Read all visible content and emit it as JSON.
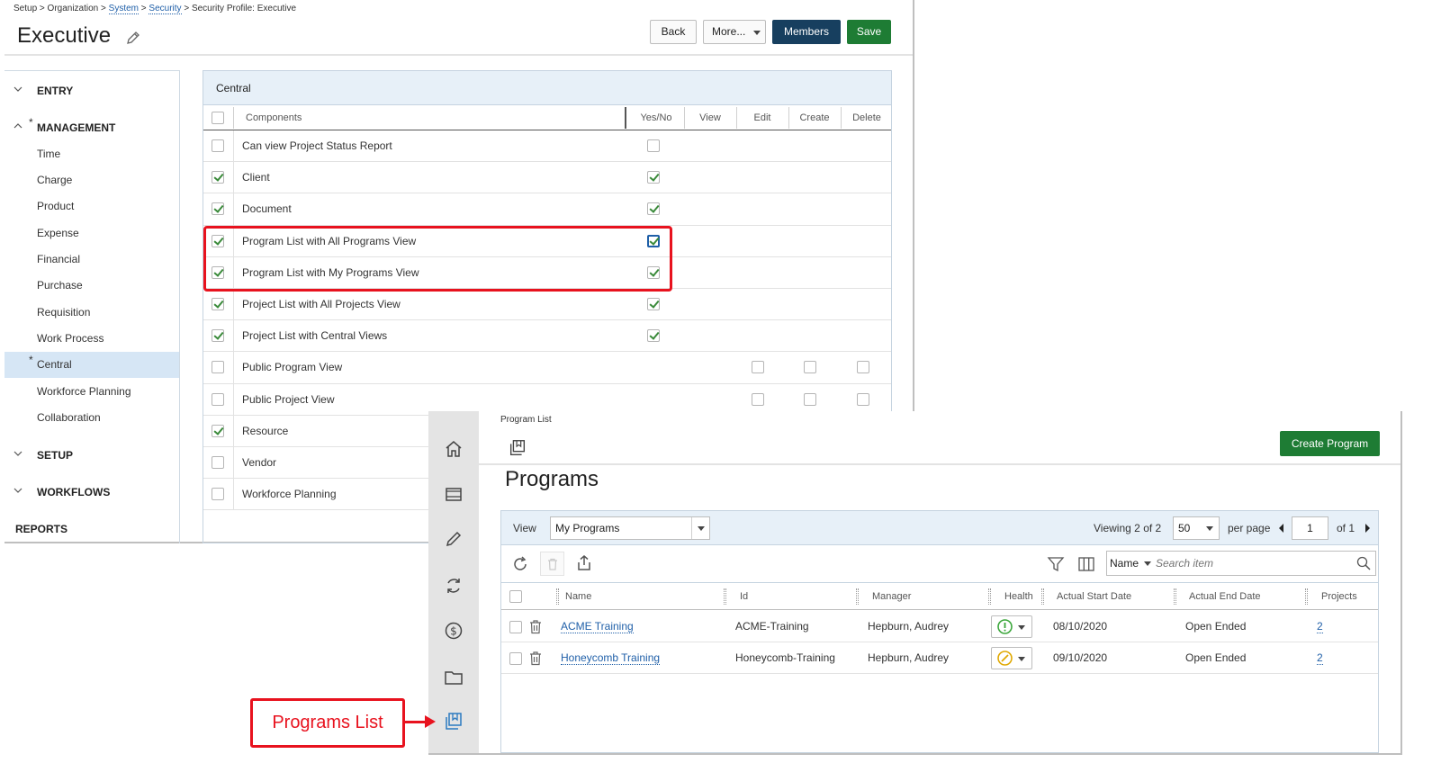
{
  "security_profile": {
    "breadcrumb": {
      "setup": "Setup",
      "sep": ">",
      "organization": "Organization",
      "system": "System",
      "security": "Security",
      "current": "Security Profile: Executive"
    },
    "title": "Executive",
    "buttons": {
      "back": "Back",
      "more": "More...",
      "members": "Members",
      "save": "Save"
    },
    "colors": {
      "members": "#173f5f",
      "save": "#1e7c34",
      "highlight": "#e8121e"
    },
    "nav": {
      "entry": "ENTRY",
      "management": "MANAGEMENT",
      "management_marker": "*",
      "items": [
        "Time",
        "Charge",
        "Product",
        "Expense",
        "Financial",
        "Purchase",
        "Requisition",
        "Work Process",
        "Central",
        "Workforce Planning",
        "Collaboration"
      ],
      "active_item": "Central",
      "active_marker": "*",
      "setup": "SETUP",
      "workflows": "WORKFLOWS",
      "reports": "REPORTS"
    },
    "components": {
      "section_title": "Central",
      "headers": {
        "components": "Components",
        "yes_no": "Yes/No",
        "view": "View",
        "edit": "Edit",
        "create": "Create",
        "delete": "Delete"
      },
      "rows": [
        {
          "label": "Can view Project Status Report",
          "selected": false,
          "yes_no": false,
          "vecd": false
        },
        {
          "label": "Client",
          "selected": true,
          "yes_no": true,
          "vecd": false
        },
        {
          "label": "Document",
          "selected": true,
          "yes_no": true,
          "vecd": false
        },
        {
          "label": "Program List with All Programs View",
          "selected": true,
          "yes_no": true,
          "vecd": false,
          "focused": true
        },
        {
          "label": "Program List with My Programs View",
          "selected": true,
          "yes_no": true,
          "vecd": false
        },
        {
          "label": "Project List with All Projects View",
          "selected": true,
          "yes_no": true,
          "vecd": false
        },
        {
          "label": "Project List with Central Views",
          "selected": true,
          "yes_no": true,
          "vecd": false
        },
        {
          "label": "Public Program View",
          "selected": false,
          "yes_no": null,
          "vecd": true
        },
        {
          "label": "Public Project View",
          "selected": false,
          "yes_no": null,
          "vecd": true
        },
        {
          "label": "Resource",
          "selected": true,
          "yes_no": null,
          "vecd": false
        },
        {
          "label": "Vendor",
          "selected": false,
          "yes_no": null,
          "vecd": false
        },
        {
          "label": "Workforce Planning",
          "selected": false,
          "yes_no": null,
          "vecd": false
        }
      ]
    }
  },
  "programs": {
    "breadcrumb": "Program List",
    "title": "Programs",
    "create_button": "Create Program",
    "view_label": "View",
    "view_value": "My Programs",
    "viewing": {
      "prefix": "Viewing",
      "current": "2",
      "of": "of",
      "total": "2"
    },
    "per_page_value": "50",
    "per_page_label": "per page",
    "page_value": "1",
    "page_of": "of 1",
    "search_field": "Name",
    "search_placeholder": "Search item",
    "columns": {
      "name": "Name",
      "id": "Id",
      "manager": "Manager",
      "health": "Health",
      "start": "Actual Start Date",
      "end": "Actual End Date",
      "projects": "Projects"
    },
    "rows": [
      {
        "name": "ACME Training",
        "id": "ACME-Training",
        "manager": "Hepburn, Audrey",
        "health": "green-exclamation-icon",
        "health_color": "#3aa63a",
        "start": "08/10/2020",
        "end": "Open Ended",
        "projects": "2"
      },
      {
        "name": "Honeycomb Training",
        "id": "Honeycomb-Training",
        "manager": "Hepburn, Audrey",
        "health": "amber-slash-icon",
        "health_color": "#e0a800",
        "start": "09/10/2020",
        "end": "Open Ended",
        "projects": "2"
      }
    ],
    "rail_icons": [
      "home-icon",
      "inbox-icon",
      "pencil-icon",
      "refresh-icon",
      "dollar-icon",
      "folder-icon",
      "program-list-icon"
    ]
  },
  "callout": {
    "text": "Programs List"
  }
}
